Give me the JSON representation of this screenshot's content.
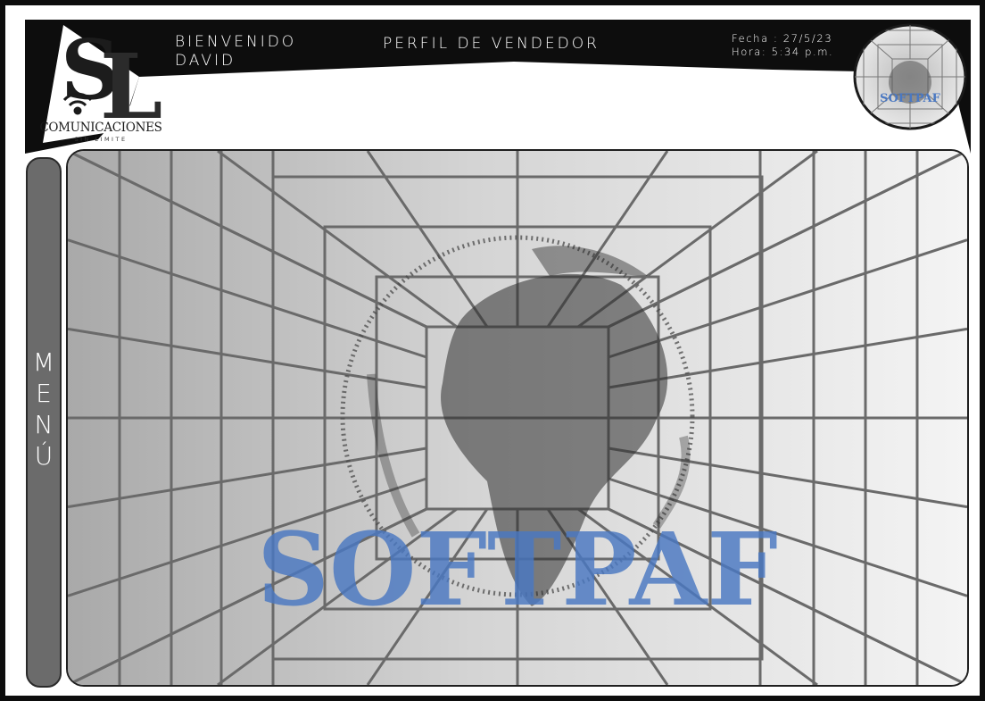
{
  "header": {
    "welcome_line1": "BIENVENIDO",
    "welcome_line2": "DAVID",
    "section_title": "PERFIL DE VENDEDOR",
    "date_line": "Fecha : 27/5/23",
    "time_line": "Hora: 5:34 p.m."
  },
  "logo": {
    "name": "COMUNICACIONES",
    "tagline": "SIN LIMITE"
  },
  "badge": {
    "brand": "SOFTPAF"
  },
  "menu": {
    "letters": [
      "M",
      "E",
      "N",
      "Ú"
    ]
  },
  "main": {
    "watermark": "SOFTPAF"
  },
  "colors": {
    "frame": "#0d0d0d",
    "menu_bg": "#6b6b6b",
    "brand_blue": "#4a78c2",
    "header_text": "#ffffff"
  },
  "icons": [
    "sl-logo-icon",
    "wifi-icon",
    "globe-icon",
    "softpaf-badge-icon"
  ]
}
